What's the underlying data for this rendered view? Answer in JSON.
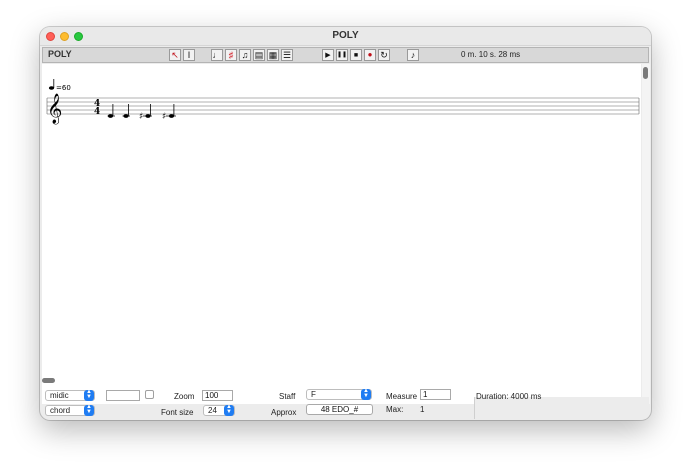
{
  "window": {
    "title": "POLY"
  },
  "toolbar": {
    "app_name": "POLY",
    "tools": [
      {
        "name": "pointer-tool-button",
        "glyph": "↖"
      },
      {
        "name": "text-cursor-tool-button",
        "glyph": "I"
      },
      {
        "name": "quarter-note-tool-button",
        "glyph": "♩"
      },
      {
        "name": "sharp-note-tool-button",
        "glyph": "♯"
      },
      {
        "name": "beamed-notes-tool-button",
        "glyph": "♫"
      },
      {
        "name": "staff-view-tool-button",
        "glyph": "▤"
      },
      {
        "name": "grid-view-tool-button",
        "glyph": "▦"
      },
      {
        "name": "layers-tool-button",
        "glyph": "☰"
      }
    ],
    "transport": [
      {
        "name": "play-button",
        "glyph": "▶"
      },
      {
        "name": "pause-button",
        "glyph": "❚❚"
      },
      {
        "name": "stop-button",
        "glyph": "■"
      },
      {
        "name": "record-button",
        "glyph": "●"
      },
      {
        "name": "loop-button",
        "glyph": "↻"
      },
      {
        "name": "metronome-button",
        "glyph": "♪"
      }
    ],
    "time_display": "0 m. 10 s. 28 ms"
  },
  "score": {
    "tempo": "=60",
    "time_signature_top": "4",
    "time_signature_bottom": "4"
  },
  "controls": {
    "mode_select": "midic",
    "type_select": "chord",
    "zoom_label": "Zoom",
    "zoom_value": "100",
    "font_size_label": "Font size",
    "font_size_value": "24",
    "staff_label": "Staff",
    "staff_value": "F",
    "approx_label": "Approx",
    "approx_value": "48 EDO_#",
    "measure_label": "Measure",
    "measure_value": "1",
    "max_label": "Max:",
    "max_value": "1",
    "duration_text": "Duration: 4000 ms"
  },
  "colors": {
    "accent": "#1f7cf2",
    "record": "#c0111a",
    "note_tool_red": "#d0151e"
  }
}
